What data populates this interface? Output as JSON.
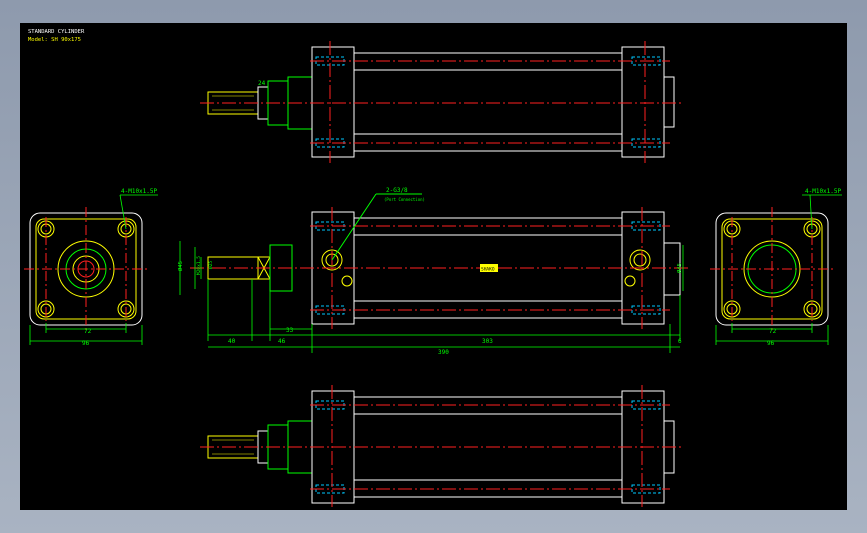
{
  "title_block": {
    "line1": "STANDARD CYLINDER",
    "line2": "Model: SH 90x175"
  },
  "labels": {
    "holes_left": "4-M10x1.5P",
    "holes_right": "4-M10x1.5P",
    "port": "2-G3/8",
    "port_note": "(Port Connection)",
    "rod_dim": "24",
    "bore_left": "Ø45",
    "rod_small": "M20x1.5",
    "rod_dia": "Ø25",
    "body_right": "Ø45",
    "stamp": "SHAKO"
  },
  "dimensions": {
    "left_inner": "72",
    "left_outer": "96",
    "right_inner": "72",
    "right_outer": "96",
    "d40": "40",
    "d46": "46",
    "d33": "33",
    "d303": "303",
    "d6": "6",
    "total": "390"
  },
  "colors": {
    "background": "#000000",
    "outline": "#ffffff",
    "centerline": "#ff2020",
    "dimension": "#00ff00",
    "yellow": "#ffff00",
    "cyan": "#00c8ff",
    "frame": "#8e9aad"
  }
}
